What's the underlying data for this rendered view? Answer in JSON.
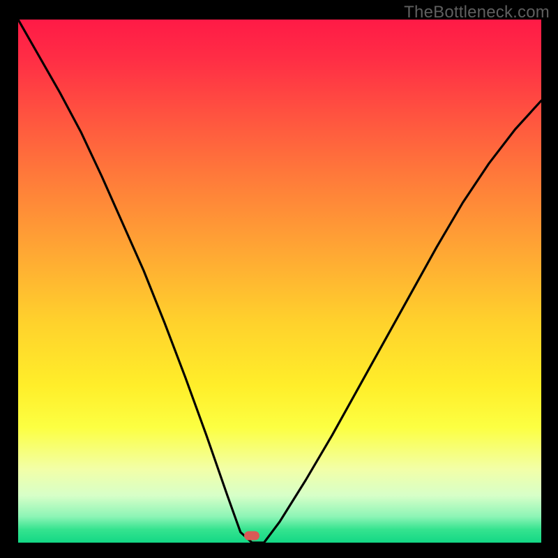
{
  "watermark": "TheBottleneck.com",
  "marker": {
    "color": "#d85a56",
    "x_frac": 0.447,
    "y_frac": 0.986
  },
  "chart_data": {
    "type": "line",
    "title": "",
    "xlabel": "",
    "ylabel": "",
    "xlim": [
      0,
      1
    ],
    "ylim": [
      0,
      1
    ],
    "x": [
      0.0,
      0.04,
      0.08,
      0.12,
      0.16,
      0.2,
      0.24,
      0.28,
      0.32,
      0.36,
      0.4,
      0.425,
      0.447,
      0.47,
      0.5,
      0.55,
      0.6,
      0.65,
      0.7,
      0.75,
      0.8,
      0.85,
      0.9,
      0.95,
      1.0
    ],
    "values": [
      1.0,
      0.93,
      0.86,
      0.785,
      0.7,
      0.61,
      0.52,
      0.42,
      0.315,
      0.205,
      0.09,
      0.02,
      0.0,
      0.0,
      0.04,
      0.12,
      0.205,
      0.295,
      0.385,
      0.475,
      0.565,
      0.65,
      0.725,
      0.79,
      0.845
    ],
    "annotations": [
      {
        "type": "marker",
        "x": 0.447,
        "y": 0.0,
        "label": "minimum"
      }
    ],
    "background": {
      "type": "vertical-gradient",
      "stops": [
        {
          "pos": 0.0,
          "color": "#ff1a46"
        },
        {
          "pos": 0.5,
          "color": "#ffc22f"
        },
        {
          "pos": 0.8,
          "color": "#fbff50"
        },
        {
          "pos": 1.0,
          "color": "#13d885"
        }
      ]
    }
  }
}
